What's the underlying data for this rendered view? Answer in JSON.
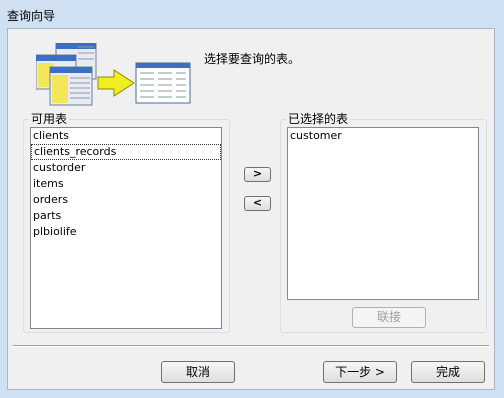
{
  "window": {
    "title": "查询向导"
  },
  "header": {
    "instruction": "选择要查询的表。"
  },
  "available": {
    "label": "可用表",
    "items": [
      "clients",
      "clients_records",
      "custorder",
      "items",
      "orders",
      "parts",
      "plbiolife"
    ]
  },
  "selected": {
    "label": "已选择的表",
    "items": [
      "customer"
    ],
    "join_label": "联接"
  },
  "move": {
    "add_label": ">",
    "remove_label": "<"
  },
  "footer": {
    "cancel_label": "取消",
    "next_label": "下一步 >",
    "finish_label": "完成"
  }
}
